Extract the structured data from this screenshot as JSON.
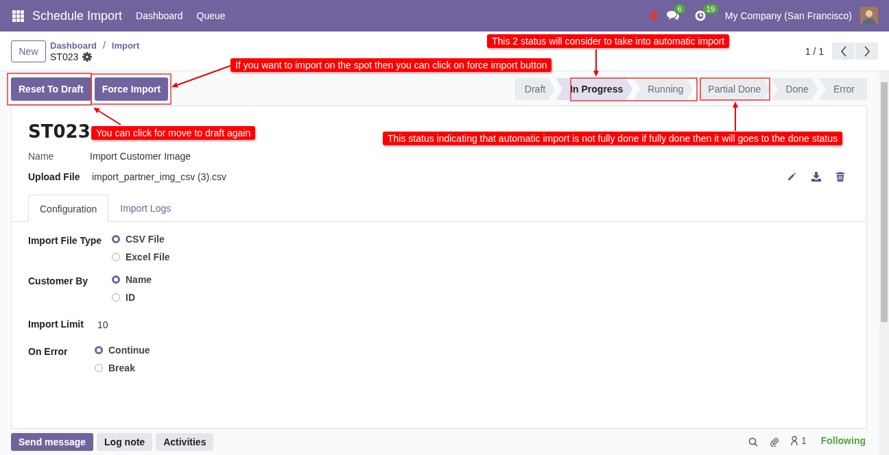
{
  "navbar": {
    "app_title": "Schedule Import",
    "menu": [
      "Dashboard",
      "Queue"
    ],
    "chat_badge": "6",
    "activity_badge": "19",
    "company": "My Company (San Francisco)"
  },
  "control_panel": {
    "new_button": "New",
    "breadcrumbs": [
      "Dashboard",
      "Import"
    ],
    "breadcrumb_separator": "/",
    "record": "ST023",
    "pager": "1 / 1"
  },
  "action_buttons": [
    "Reset To Draft",
    "Force Import"
  ],
  "stages": [
    {
      "label": "Draft",
      "selected": false
    },
    {
      "label": "In Progress",
      "selected": true
    },
    {
      "label": "Running",
      "selected": false
    },
    {
      "label": "Partial Done",
      "selected": false
    },
    {
      "label": "Done",
      "selected": false
    },
    {
      "label": "Error",
      "selected": false
    }
  ],
  "form": {
    "title": "ST023",
    "name_label": "Name",
    "name_value": "Import Customer Image",
    "upload_label": "Upload File",
    "upload_value": "import_partner_img_csv (3).csv",
    "tabs": [
      {
        "label": "Configuration",
        "selected": true
      },
      {
        "label": "Import Logs",
        "selected": false
      }
    ],
    "groups": [
      [
        {
          "label": "Import File Type",
          "kind": "radio",
          "options": [
            {
              "label": "CSV File",
              "selected": true
            },
            {
              "label": "Excel File",
              "selected": false
            }
          ]
        },
        {
          "label": "Customer By",
          "kind": "radio",
          "options": [
            {
              "label": "Name",
              "selected": true
            },
            {
              "label": "ID",
              "selected": false
            }
          ]
        }
      ],
      [
        {
          "label": "Import Limit",
          "kind": "text",
          "value": "10"
        },
        {
          "label": "On Error",
          "kind": "radio",
          "options": [
            {
              "label": "Continue",
              "selected": true
            },
            {
              "label": "Break",
              "selected": false
            }
          ]
        }
      ]
    ]
  },
  "chatter": {
    "buttons": [
      {
        "label": "Send message",
        "selected": true
      },
      {
        "label": "Log note",
        "selected": false
      },
      {
        "label": "Activities",
        "selected": false
      }
    ],
    "followers": "1",
    "follow_status": "Following"
  },
  "annotations": [
    "This 2 status will consider to take into automatic import",
    "If you want to import on the spot then you can click on force import button",
    "You can click for move to draft again",
    "This status indicating that automatic import is not fully done if fully done then it will goes to the done status"
  ]
}
